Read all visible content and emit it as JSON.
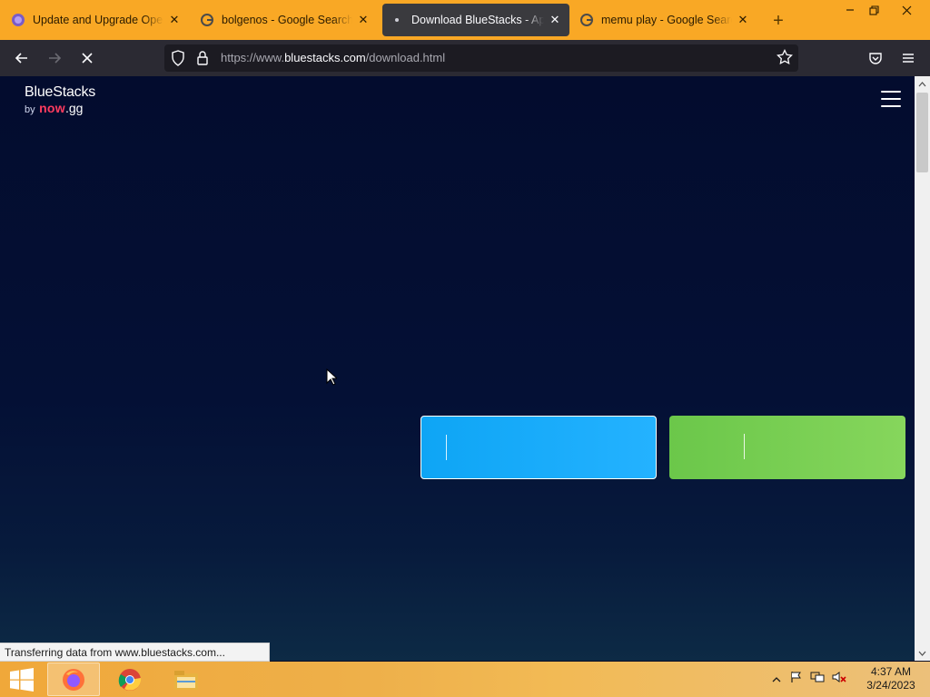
{
  "browser": {
    "tabs": [
      {
        "title": "Update and Upgrade Open G",
        "favicon": "openguru-icon",
        "active": false
      },
      {
        "title": "bolgenos - Google Search",
        "favicon": "google-icon",
        "active": false
      },
      {
        "title": "Download BlueStacks - App P",
        "favicon": "loading-dot-icon",
        "active": true
      },
      {
        "title": "memu play - Google Search",
        "favicon": "google-icon",
        "active": false
      }
    ],
    "url_prefix": "https://www.",
    "url_domain": "bluestacks.com",
    "url_path": "/download.html",
    "status_text": "Transferring data from www.bluestacks.com..."
  },
  "page": {
    "logo": {
      "brand": "BlueStacks",
      "by": "by",
      "now": "now",
      "gg": ".gg"
    },
    "accent_blue": "#1aa9f8",
    "accent_green": "#7ccf53"
  },
  "taskbar": {
    "apps": [
      "firefox-icon",
      "chrome-icon",
      "file-explorer-icon"
    ],
    "time": "4:37 AM",
    "date": "3/24/2023"
  }
}
